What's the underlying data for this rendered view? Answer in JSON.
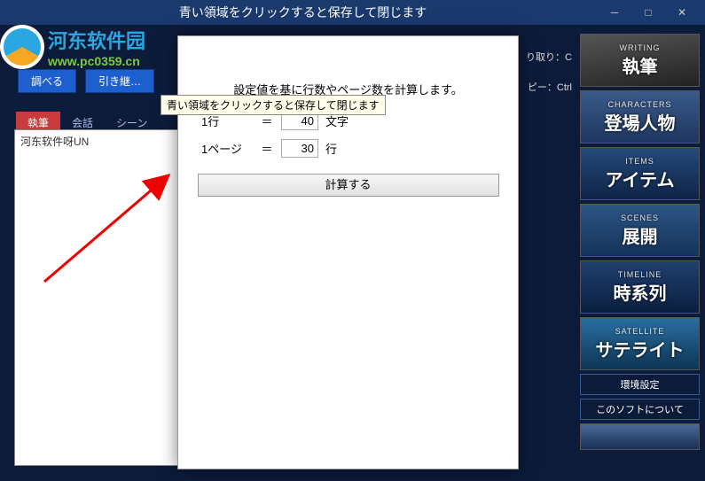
{
  "titlebar": {
    "text": "青い領域をクリックすると保存して閉じます"
  },
  "logo": {
    "main": "河东软件园",
    "sub": "www.pc0359.cn"
  },
  "toolbar": {
    "btn1": "調べる",
    "btn2": "引き継…"
  },
  "shortcuts": {
    "cut_hint": "り取り：C",
    "copy_hint": "ピー：Ctrl"
  },
  "tabs": {
    "t1": "執筆",
    "t2": "会話",
    "t3": "シーン"
  },
  "editor": {
    "content": "河东软件呀UN"
  },
  "modal": {
    "desc": "設定値を基に行数やページ数を計算します。",
    "tooltip": "青い領域をクリックすると保存して閉じます",
    "row1_label": "1行",
    "row1_eq": "＝",
    "row1_value": "40",
    "row1_unit": "文字",
    "row2_label": "1ページ",
    "row2_eq": "＝",
    "row2_value": "30",
    "row2_unit": "行",
    "calc_btn": "計算する"
  },
  "rightnav": {
    "items": [
      {
        "eng": "WRITING",
        "jp": "執筆"
      },
      {
        "eng": "CHARACTERS",
        "jp": "登場人物"
      },
      {
        "eng": "ITEMS",
        "jp": "アイテム"
      },
      {
        "eng": "SCENES",
        "jp": "展開"
      },
      {
        "eng": "TIMELINE",
        "jp": "時系列"
      },
      {
        "eng": "SATELLITE",
        "jp": "サテライト"
      }
    ],
    "small1": "環境設定",
    "small2": "このソフトについて"
  }
}
